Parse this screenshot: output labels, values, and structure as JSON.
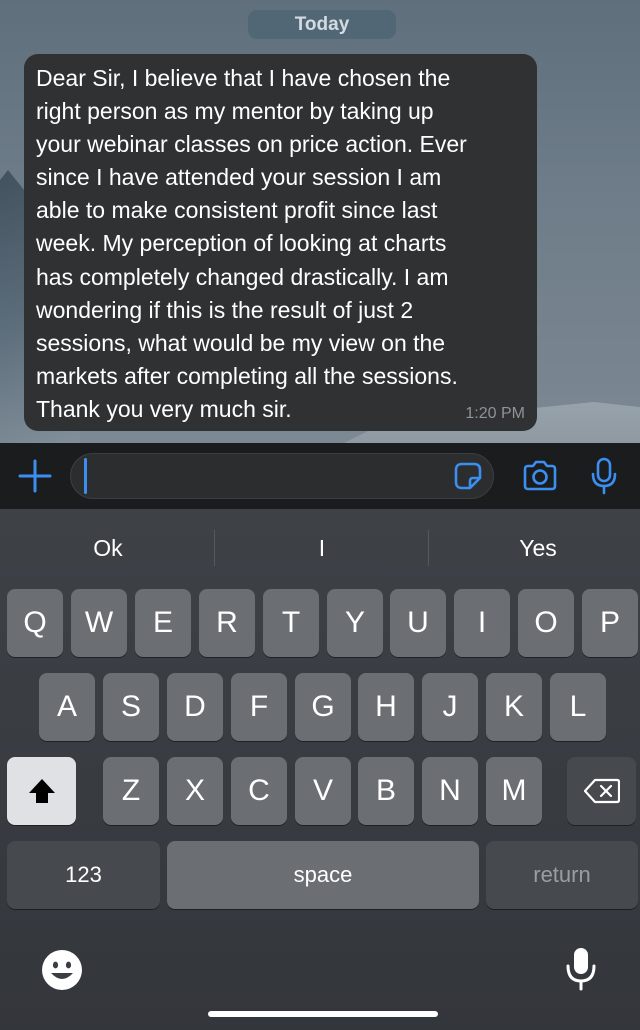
{
  "chat": {
    "date_label": "Today",
    "message": {
      "lines": [
        "Dear Sir, I believe that I have chosen the",
        "right person as my mentor by taking up",
        "your webinar classes on price action. Ever",
        "since I have attended your session I am",
        "able to make consistent profit since last",
        "week. My perception of looking at charts",
        "has completely changed drastically. I am",
        "wondering if this is the result of just 2",
        "sessions, what would be my view on the",
        "markets after completing all the sessions.",
        "Thank you very much sir."
      ],
      "time": "1:20 PM"
    }
  },
  "input_bar": {
    "value": "",
    "icons": [
      "plus-icon",
      "sticker-icon",
      "camera-icon",
      "microphone-icon"
    ],
    "accent_color": "#3b8ff0"
  },
  "keyboard": {
    "suggestions": [
      "Ok",
      "I",
      "Yes"
    ],
    "row1": [
      "Q",
      "W",
      "E",
      "R",
      "T",
      "Y",
      "U",
      "I",
      "O",
      "P"
    ],
    "row2": [
      "A",
      "S",
      "D",
      "F",
      "G",
      "H",
      "J",
      "K",
      "L"
    ],
    "row3": [
      "Z",
      "X",
      "C",
      "V",
      "B",
      "N",
      "M"
    ],
    "numbers_label": "123",
    "space_label": "space",
    "return_label": "return",
    "icons": [
      "shift-icon",
      "backspace-icon",
      "emoji-icon",
      "dictation-mic-icon"
    ]
  }
}
